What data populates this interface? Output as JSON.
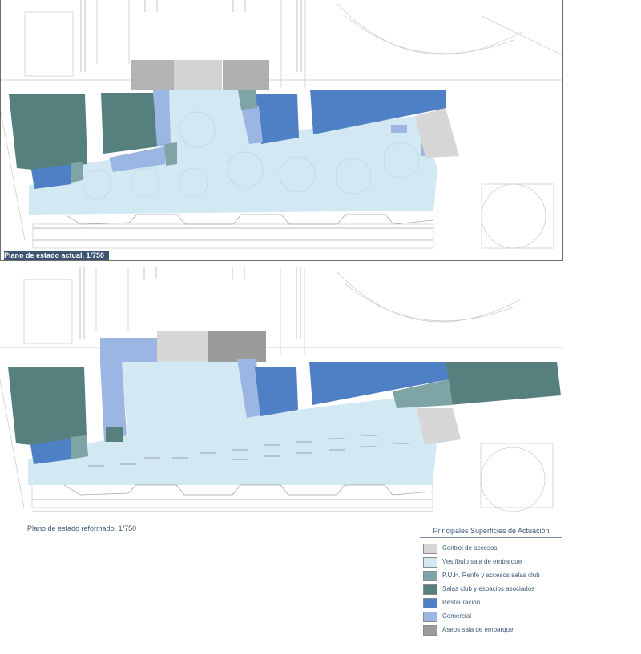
{
  "captions": {
    "top": "Plano de estado actual. 1/750",
    "bottom": "Plano de estado reformado. 1/750"
  },
  "legend": {
    "title": "Principales Superficies de Actuación",
    "items": [
      {
        "label": "Control de accesos",
        "color": "#d6d6d6"
      },
      {
        "label": "Vestíbulo sala de embarque",
        "color": "#d2e9f3"
      },
      {
        "label": "P.U.H. Renfe y accesos salas club",
        "color": "#7fa4a6"
      },
      {
        "label": "Salas club y espacios asociados",
        "color": "#56807e"
      },
      {
        "label": "Restauración",
        "color": "#4f7fc4"
      },
      {
        "label": "Comercial",
        "color": "#9bb6e3"
      },
      {
        "label": "Aseos sala de embarque",
        "color": "#9b9b9b"
      }
    ]
  }
}
